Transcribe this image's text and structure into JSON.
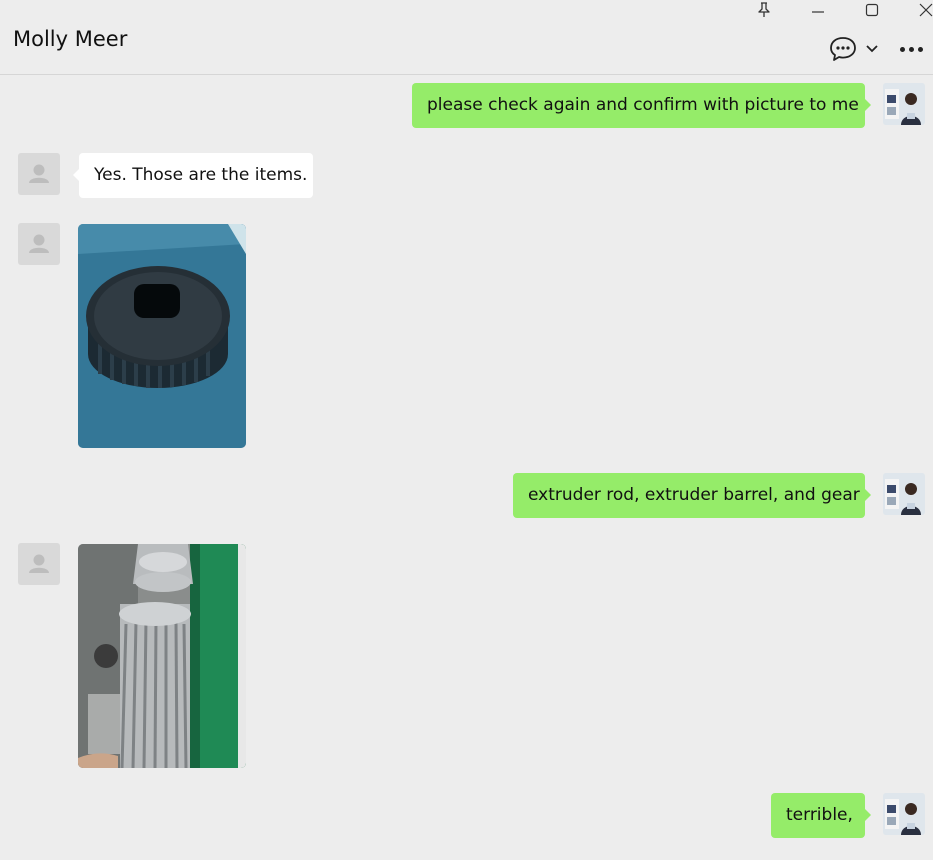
{
  "window": {
    "contact_name": "Molly Meer",
    "controls": [
      "pin-icon",
      "minimize-icon",
      "maximize-icon",
      "close-icon"
    ],
    "toolbar_icons": [
      "chat-bubble-icon",
      "chevron-down-icon",
      "more-icon"
    ]
  },
  "colors": {
    "background": "#ededed",
    "outgoing_bubble": "#95ec69",
    "incoming_bubble": "#ffffff"
  },
  "messages": [
    {
      "from": "me",
      "type": "text",
      "text": "please check again and confirm with picture to me"
    },
    {
      "from": "contact",
      "type": "text",
      "text": "Yes. Those are the items."
    },
    {
      "from": "contact",
      "type": "image",
      "image": "gear-photo"
    },
    {
      "from": "me",
      "type": "text",
      "text": "extruder rod, extruder barrel, and gear"
    },
    {
      "from": "contact",
      "type": "image",
      "image": "extruder-rod-photo"
    },
    {
      "from": "me",
      "type": "text",
      "text": "terrible,"
    }
  ]
}
